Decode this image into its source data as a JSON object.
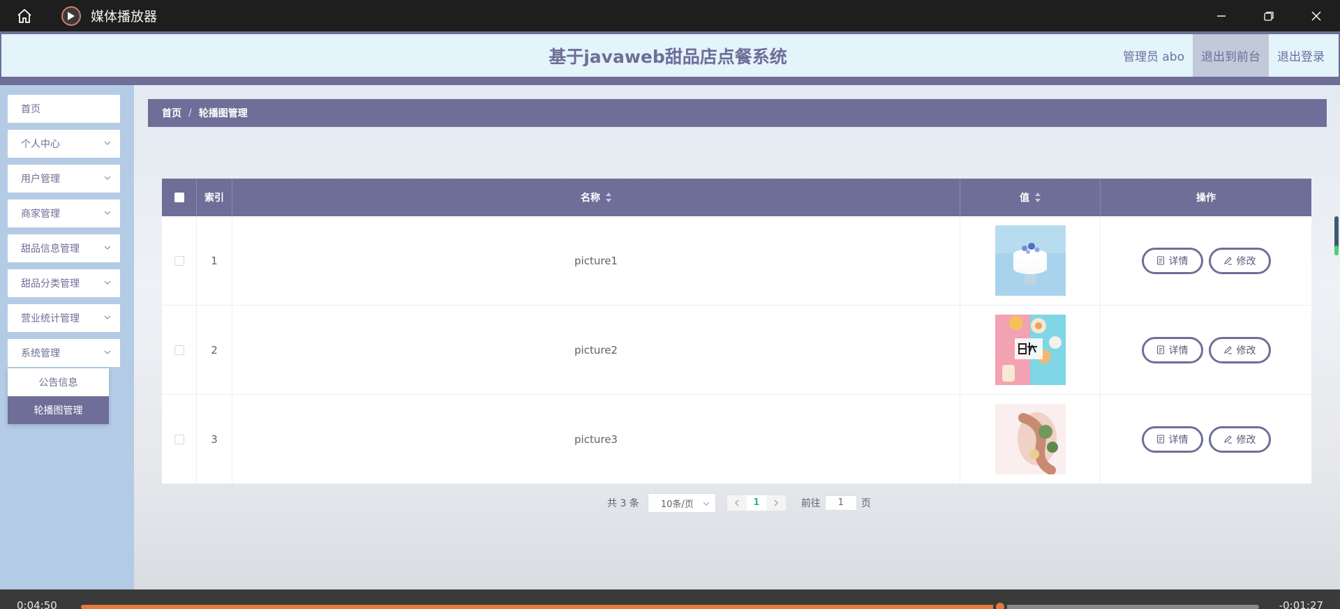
{
  "window": {
    "title": "媒体播放器"
  },
  "header": {
    "title": "基于javaweb甜品店点餐系统",
    "user": "管理员 abo",
    "exit_front": "退出到前台",
    "logout": "退出登录"
  },
  "sidebar": {
    "items": [
      {
        "label": "首页"
      },
      {
        "label": "个人中心"
      },
      {
        "label": "用户管理"
      },
      {
        "label": "商家管理"
      },
      {
        "label": "甜品信息管理"
      },
      {
        "label": "甜品分类管理"
      },
      {
        "label": "营业统计管理"
      },
      {
        "label": "系统管理"
      }
    ],
    "submenu": [
      {
        "label": "公告信息"
      },
      {
        "label": "轮播图管理"
      }
    ]
  },
  "breadcrumb": {
    "home": "首页",
    "sep": "/",
    "current": "轮播图管理"
  },
  "table": {
    "headers": {
      "index": "索引",
      "name": "名称",
      "value": "值",
      "actions": "操作"
    },
    "rows": [
      {
        "index": "1",
        "name": "picture1",
        "detail": "详情",
        "edit": "修改"
      },
      {
        "index": "2",
        "name": "picture2",
        "detail": "详情",
        "edit": "修改"
      },
      {
        "index": "3",
        "name": "picture3",
        "detail": "详情",
        "edit": "修改"
      }
    ]
  },
  "pagination": {
    "total": "共 3 条",
    "page_size": "10条/页",
    "current_page": "1",
    "goto_prefix": "前往",
    "goto_value": "1",
    "goto_suffix": "页"
  },
  "player": {
    "elapsed": "0:04:50",
    "remaining": "-0:01:27",
    "progress": 0.78
  },
  "colors": {
    "accent": "#6e6e98",
    "header_bg": "#e4f4fb",
    "sidebar_bg": "#b4cbe6",
    "progress": "#e67a3b"
  }
}
